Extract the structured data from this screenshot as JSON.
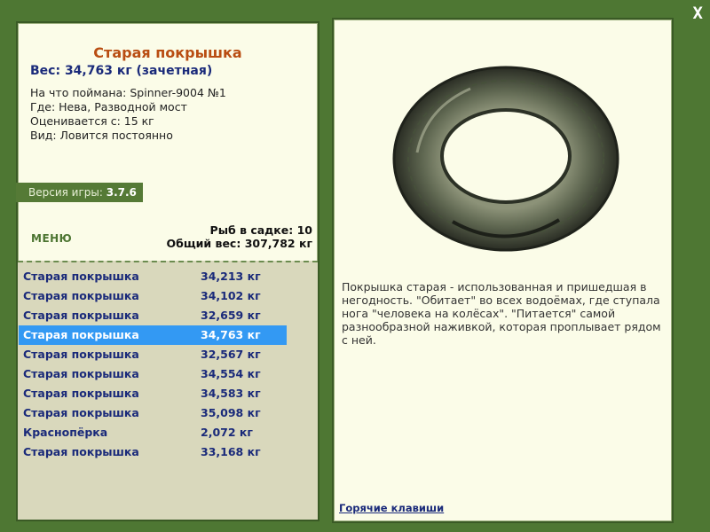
{
  "close_label": "X",
  "fish": {
    "name": "Старая покрышка",
    "weight": "Вес: 34,763 кг (зачетная)",
    "caught_on": "На что поймана: Spinner-9004 №1",
    "where": "Где: Нева, Разводной мост",
    "evaluated_from": "Оценивается с: 15 кг",
    "kind": "Вид: Ловится постоянно",
    "description": "Покрышка старая - использованная и пришедшая в негодность. \"Обитает\" во всех водоёмах, где ступала нога \"человека на колёсах\". \"Питается\" самой разнообразной наживкой, которая проплывает рядом с ней.",
    "image_icon": "tire-icon"
  },
  "version": {
    "label": "Версия игры:",
    "value": "3.7.6"
  },
  "menu_label": "МЕНЮ",
  "cage": {
    "count": "Рыб в садке: 10",
    "total": "Общий вес: 307,782 кг"
  },
  "catches": [
    {
      "name": "Старая покрышка",
      "weight": "34,213 кг",
      "selected": false
    },
    {
      "name": "Старая покрышка",
      "weight": "34,102 кг",
      "selected": false
    },
    {
      "name": "Старая покрышка",
      "weight": "32,659 кг",
      "selected": false
    },
    {
      "name": "Старая покрышка",
      "weight": "34,763 кг",
      "selected": true
    },
    {
      "name": "Старая покрышка",
      "weight": "32,567 кг",
      "selected": false
    },
    {
      "name": "Старая покрышка",
      "weight": "34,554 кг",
      "selected": false
    },
    {
      "name": "Старая покрышка",
      "weight": "34,583 кг",
      "selected": false
    },
    {
      "name": "Старая покрышка",
      "weight": "35,098 кг",
      "selected": false
    },
    {
      "name": "Краснопёрка",
      "weight": "2,072 кг",
      "selected": false
    },
    {
      "name": "Старая покрышка",
      "weight": "33,168 кг",
      "selected": false
    }
  ],
  "hotkeys_label": "Горячие клавиши",
  "colors": {
    "background": "#4e7733",
    "panel": "#fbfce8",
    "title": "#b94d12",
    "selected_row": "#3399f3"
  }
}
